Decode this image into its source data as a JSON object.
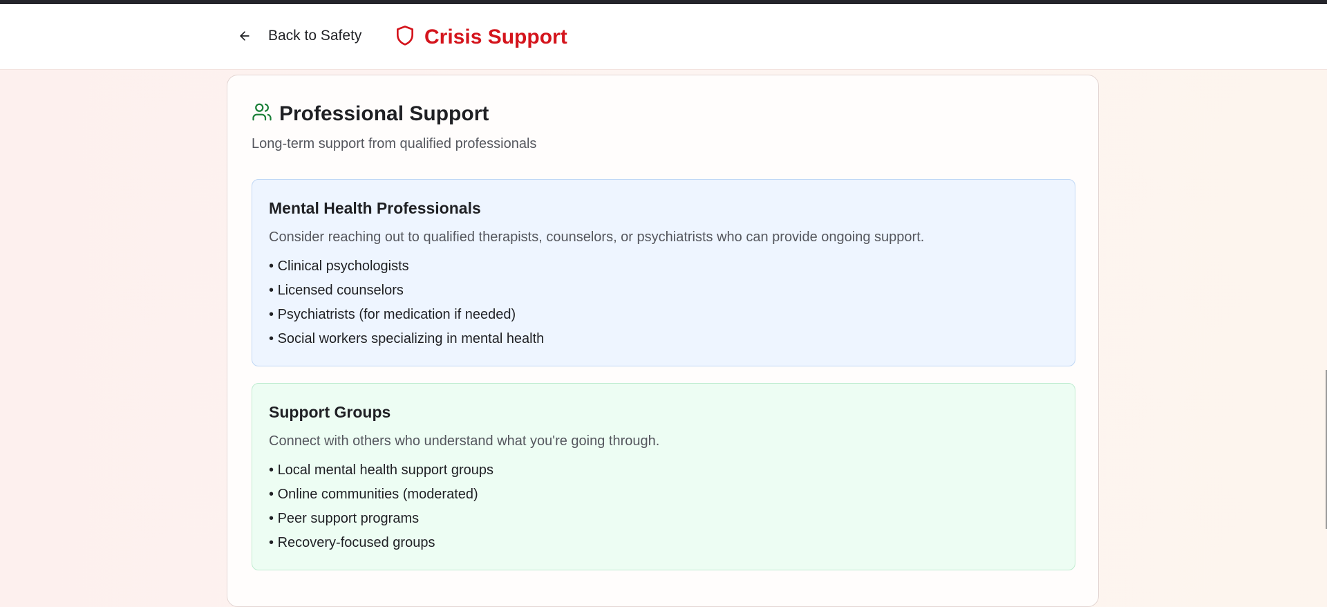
{
  "header": {
    "back_label": "Back to Safety",
    "brand_title": "Crisis Support"
  },
  "card": {
    "title": "Professional Support",
    "subtitle": "Long-term support from qualified professionals",
    "sections": [
      {
        "title": "Mental Health Professionals",
        "description": "Consider reaching out to qualified therapists, counselors, or psychiatrists who can provide ongoing support.",
        "items": [
          "Clinical psychologists",
          "Licensed counselors",
          "Psychiatrists (for medication if needed)",
          "Social workers specializing in mental health"
        ]
      },
      {
        "title": "Support Groups",
        "description": "Connect with others who understand what you're going through.",
        "items": [
          "Local mental health support groups",
          "Online communities (moderated)",
          "Peer support programs",
          "Recovery-focused groups"
        ]
      }
    ]
  },
  "icons": {
    "back": "arrow-left-icon",
    "brand": "shield-icon",
    "card": "users-icon"
  },
  "colors": {
    "brand_red": "#d4141c",
    "users_icon_green": "#1a7f37",
    "blue_section_bg": "#eef5ff",
    "green_section_bg": "#edfdf3"
  }
}
